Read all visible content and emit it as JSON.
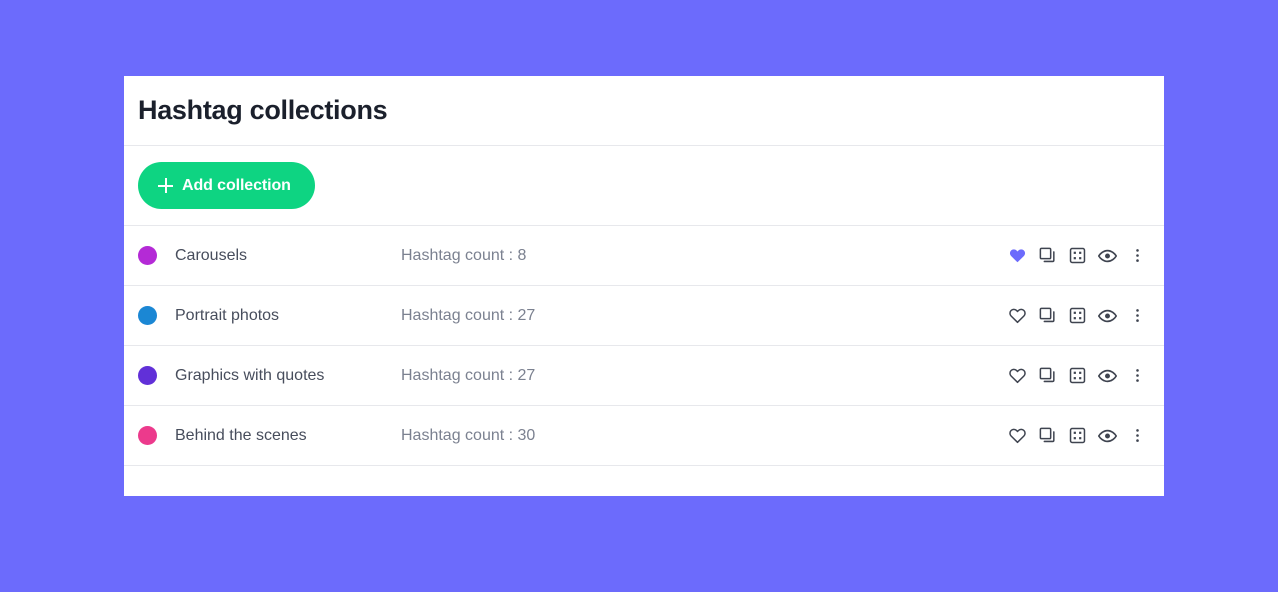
{
  "background_color": "#6c6bfc",
  "card": {
    "background": "#ffffff",
    "header": {
      "title": "Hashtag collections"
    },
    "toolbar": {
      "add_button_label": "Add collection",
      "add_button_color": "#0ed482",
      "add_icon": "plus-icon"
    },
    "collections": [
      {
        "name": "Carousels",
        "count_label": "Hashtag count : 8",
        "dot_color": "#b42ad6",
        "favorite": true,
        "favorite_color": "#6c6bfc"
      },
      {
        "name": "Portrait photos",
        "count_label": "Hashtag count : 27",
        "dot_color": "#1b87d4",
        "favorite": false,
        "favorite_color": "#6c6bfc"
      },
      {
        "name": "Graphics with quotes",
        "count_label": "Hashtag count : 27",
        "dot_color": "#6130d8",
        "favorite": false,
        "favorite_color": "#6c6bfc"
      },
      {
        "name": "Behind the scenes",
        "count_label": "Hashtag count : 30",
        "dot_color": "#ec3a8c",
        "favorite": false,
        "favorite_color": "#6c6bfc"
      }
    ],
    "row_action_icons": [
      "heart-icon",
      "copy-icon",
      "grid-dots-icon",
      "eye-icon",
      "more-vertical-icon"
    ]
  }
}
